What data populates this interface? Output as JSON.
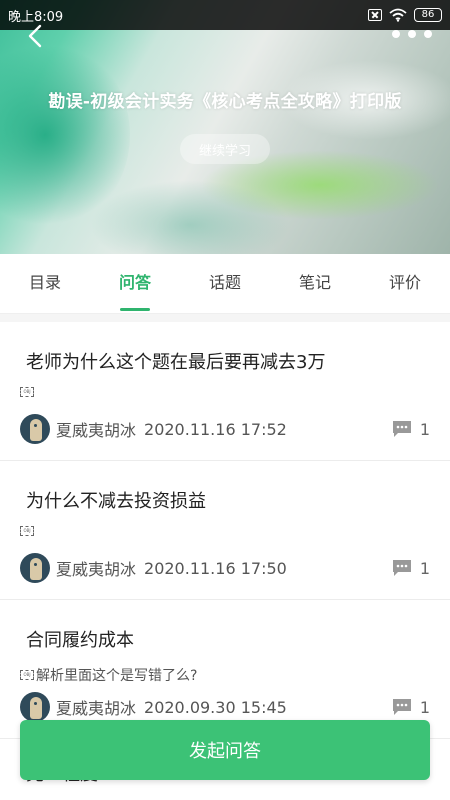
{
  "status_bar": {
    "time": "晚上8:09",
    "battery": "86",
    "icons": [
      "sim-off-icon",
      "wifi-icon",
      "battery-icon"
    ]
  },
  "header": {
    "back_icon": "chevron-left-icon",
    "more_icon": "more-dots-icon",
    "title": "勘误-初级会计实务《核心考点全攻略》打印版",
    "continue_label": "继续学习"
  },
  "tabs": [
    {
      "label": "目录",
      "active": false
    },
    {
      "label": "问答",
      "active": true
    },
    {
      "label": "话题",
      "active": false
    },
    {
      "label": "笔记",
      "active": false
    },
    {
      "label": "评价",
      "active": false
    }
  ],
  "questions": [
    {
      "title": "老师为什么这个题在最后要再减去3万",
      "desc": "",
      "author": "夏威夷胡冰",
      "time": "2020.11.16 17:52",
      "comments": "1"
    },
    {
      "title": "为什么不减去投资损益",
      "desc": "",
      "author": "夏威夷胡冰",
      "time": "2020.11.16 17:50",
      "comments": "1"
    },
    {
      "title": "合同履约成本",
      "desc": "解析里面这个是写错了么?",
      "author": "夏威夷胡冰",
      "time": "2020.09.30 15:45",
      "comments": "1"
    }
  ],
  "next_question_peek": "完工程度",
  "ask_button_label": "发起问答",
  "colors": {
    "accent": "#2fb46e",
    "button": "#3cc276"
  }
}
